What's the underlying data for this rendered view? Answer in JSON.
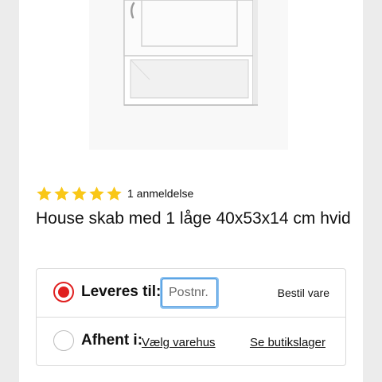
{
  "product": {
    "image_alt": "House skab med 1 låge 40x53x14 cm hvid",
    "rating": 5,
    "rating_max": 5,
    "review_count_label": "1 anmeldelse",
    "title": "House skab med 1 låge 40x53x14 cm hvid"
  },
  "delivery": {
    "deliver": {
      "label": "Leveres til:",
      "postcode_placeholder": "Postnr.",
      "postcode_value": "",
      "action_label": "Bestil vare",
      "selected": true
    },
    "pickup": {
      "label": "Afhent i:",
      "store_link": "Vælg varehus",
      "stock_link": "Se butikslager",
      "selected": false
    }
  },
  "colors": {
    "accent_red": "#e02020",
    "star_yellow": "#f9c718",
    "focus_blue": "#1f7fd6"
  },
  "icons": [
    "star-icon",
    "radio-selected-icon",
    "radio-unselected-icon"
  ]
}
